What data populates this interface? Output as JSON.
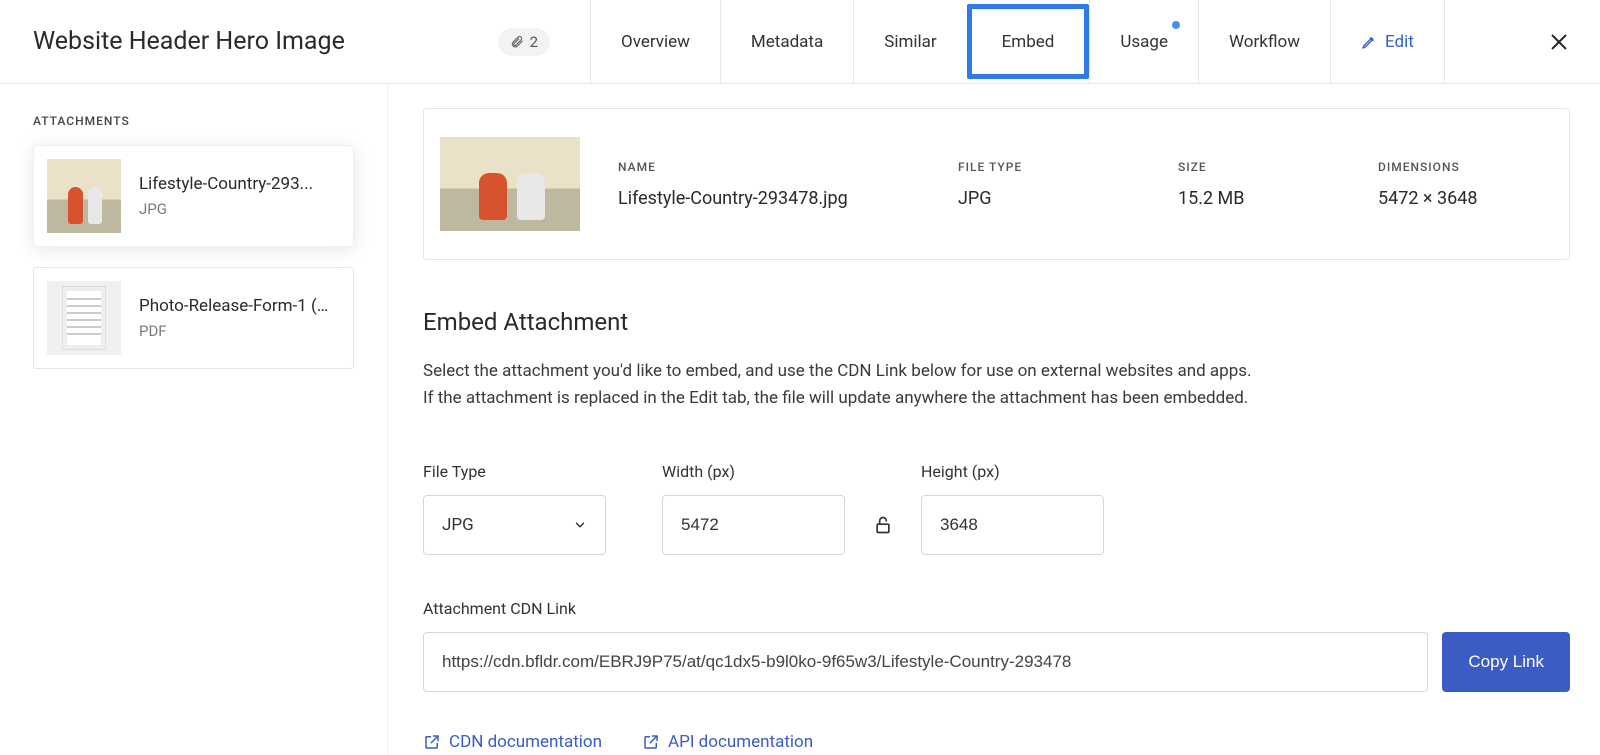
{
  "header": {
    "title": "Website Header Hero Image",
    "attachment_count": "2",
    "tabs": {
      "overview": "Overview",
      "metadata": "Metadata",
      "similar": "Similar",
      "embed": "Embed",
      "usage": "Usage",
      "workflow": "Workflow",
      "edit": "Edit"
    }
  },
  "sidebar": {
    "title": "ATTACHMENTS",
    "items": [
      {
        "name": "Lifestyle-Country-293...",
        "type": "JPG"
      },
      {
        "name": "Photo-Release-Form-1 (...",
        "type": "PDF"
      }
    ]
  },
  "info": {
    "labels": {
      "name": "NAME",
      "file_type": "FILE TYPE",
      "size": "SIZE",
      "dimensions": "DIMENSIONS"
    },
    "values": {
      "name": "Lifestyle-Country-293478.jpg",
      "file_type": "JPG",
      "size": "15.2 MB",
      "dimensions": "5472 × 3648"
    }
  },
  "embed": {
    "section_title": "Embed Attachment",
    "desc_line1": "Select the attachment you'd like to embed, and use the CDN Link below for use on external websites and apps.",
    "desc_line2": "If the attachment is replaced in the Edit tab, the file will update anywhere the attachment has been embedded.",
    "file_type_label": "File Type",
    "file_type_value": "JPG",
    "width_label": "Width (px)",
    "width_value": "5472",
    "height_label": "Height (px)",
    "height_value": "3648",
    "cdn_label": "Attachment CDN Link",
    "cdn_value": "https://cdn.bfldr.com/EBRJ9P75/at/qc1dx5-b9l0ko-9f65w3/Lifestyle-Country-293478",
    "copy_button": "Copy Link",
    "cdn_doc": "CDN documentation",
    "api_doc": "API documentation"
  }
}
